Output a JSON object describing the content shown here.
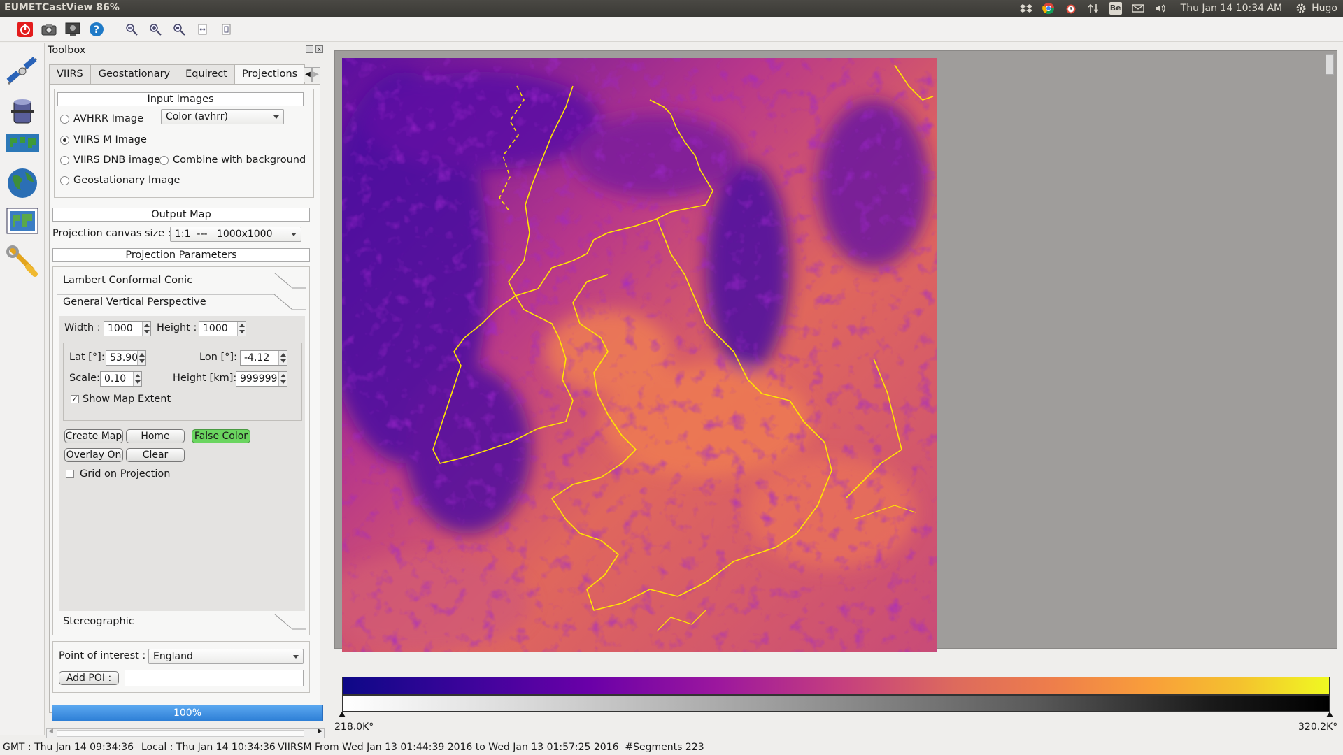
{
  "window": {
    "title": "EUMETCastView 86%"
  },
  "system_tray": {
    "datetime": "Thu Jan 14 10:34 AM",
    "user": "Hugo",
    "be_badge": "Be"
  },
  "toolbox": {
    "title": "Toolbox",
    "tabs": [
      "VIIRS",
      "Geostationary",
      "Equirect",
      "Projections"
    ],
    "active_tab": "Projections",
    "input_images": {
      "title": "Input Images",
      "options": [
        "AVHRR Image",
        "VIIRS M Image",
        "VIIRS DNB image",
        "Geostationary Image"
      ],
      "selected": "VIIRS M Image",
      "combine_label": "Combine with background",
      "color_combo": "Color   (avhrr)"
    },
    "output_map": {
      "title": "Output Map",
      "canvas_size_label": "Projection canvas size :",
      "canvas_size_value": "1:1  ---   1000x1000"
    },
    "projection_parameters": {
      "title": "Projection Parameters",
      "sections": [
        "Lambert Conformal Conic",
        "General Vertical Perspective",
        "Stereographic"
      ],
      "width_label": "Width :",
      "width_value": "1000",
      "height_label": "Height :",
      "height_value": "1000",
      "lat_label": "Lat [°]:",
      "lat_value": "53.90",
      "lon_label": "Lon [°]:",
      "lon_value": "-4.12",
      "scale_label": "Scale:",
      "scale_value": "0.10",
      "height_km_label": "Height [km]:",
      "height_km_value": "999999",
      "show_map_extent": "Show Map Extent",
      "buttons": {
        "create_map": "Create Map",
        "home": "Home",
        "false_color": "False Color",
        "overlay_on": "Overlay On",
        "clear": "Clear"
      },
      "grid_on_projection": "Grid on Projection"
    },
    "poi": {
      "label": "Point of interest :",
      "value": "England",
      "add_button": "Add POI :",
      "add_input_value": ""
    },
    "progress": {
      "text": "100%",
      "value": 1.0
    }
  },
  "colorbar": {
    "min_label": "218.0K°",
    "max_label": "320.2K°"
  },
  "status_bar": {
    "gmt": "GMT : Thu Jan 14 09:34:36",
    "local": "Local : Thu Jan 14 10:34:36",
    "info": "VIIRSM From Wed Jan 13 01:44:39 2016 to Wed Jan 13 01:57:25 2016  #Segments 223"
  },
  "colors": {
    "accent_green": "#6ad55f",
    "progress_blue": "#3c8fe0",
    "coastline": "#ffe600"
  }
}
